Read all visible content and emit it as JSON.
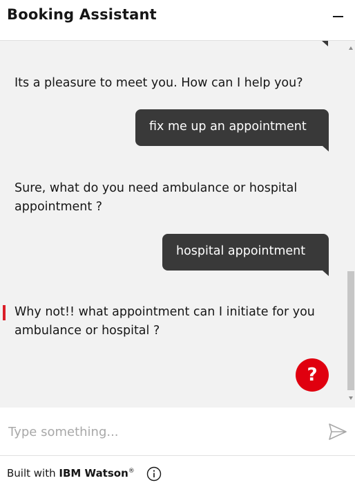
{
  "header": {
    "title": "Booking Assistant",
    "minimize_icon": "minimize-icon"
  },
  "messages": [
    {
      "from": "bot",
      "text": "Its a pleasure to meet you. How can I help you?"
    },
    {
      "from": "user",
      "text": "fix me up an appointment"
    },
    {
      "from": "bot",
      "text": "Sure, what do you need ambulance or hospital appointment ?"
    },
    {
      "from": "user",
      "text": "hospital appointment"
    },
    {
      "from": "bot",
      "text": "Why not!! what appointment can I initiate for you ambulance or hospital ?"
    }
  ],
  "help_button": {
    "label": "?",
    "icon": "help-icon",
    "color": "#e0000f"
  },
  "input": {
    "placeholder": "Type something...",
    "value": "",
    "send_icon": "send-icon"
  },
  "footer": {
    "built_with": "Built with",
    "brand": "IBM Watson",
    "registered": "®",
    "info_icon": "info-icon"
  },
  "colors": {
    "bubble": "#393939",
    "chat_bg": "#f2f2f2",
    "focus_bar": "#da1e28"
  }
}
